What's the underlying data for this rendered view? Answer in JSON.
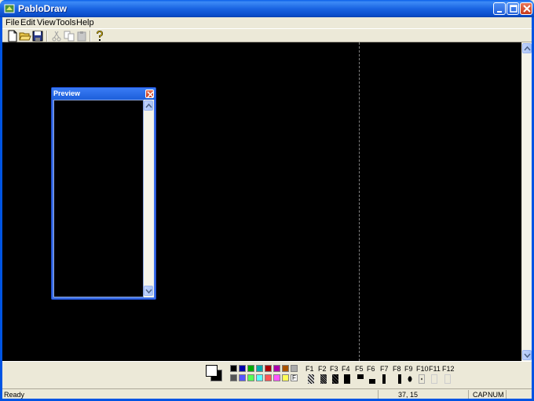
{
  "window": {
    "title": "PabloDraw"
  },
  "menu": [
    "File",
    "Edit",
    "View",
    "Tools",
    "Help"
  ],
  "toolbar_icons": [
    "new-file-icon",
    "open-folder-icon",
    "save-icon",
    "cut-icon",
    "copy-icon",
    "paste-icon",
    "help-icon"
  ],
  "preview": {
    "title": "Preview"
  },
  "palette": {
    "colors_row1": [
      "#000000",
      "#0000AA",
      "#00AA00",
      "#00AAAA",
      "#AA0000",
      "#AA00AA",
      "#AA5500",
      "#AAAAAA"
    ],
    "colors_row2": [
      "#555555",
      "#5555FF",
      "#55FF55",
      "#55FFFF",
      "#FF5555",
      "#FF55FF",
      "#FFFF55",
      "#FFFFFF"
    ],
    "selected_marker": "F"
  },
  "fkeys": [
    "F1",
    "F2",
    "F3",
    "F4",
    "F5",
    "F6",
    "F7",
    "F8",
    "F9",
    "F10",
    "F11",
    "F12"
  ],
  "status": {
    "text": "Ready",
    "position": "37, 15",
    "cap": "CAP",
    "num": "NUM"
  }
}
